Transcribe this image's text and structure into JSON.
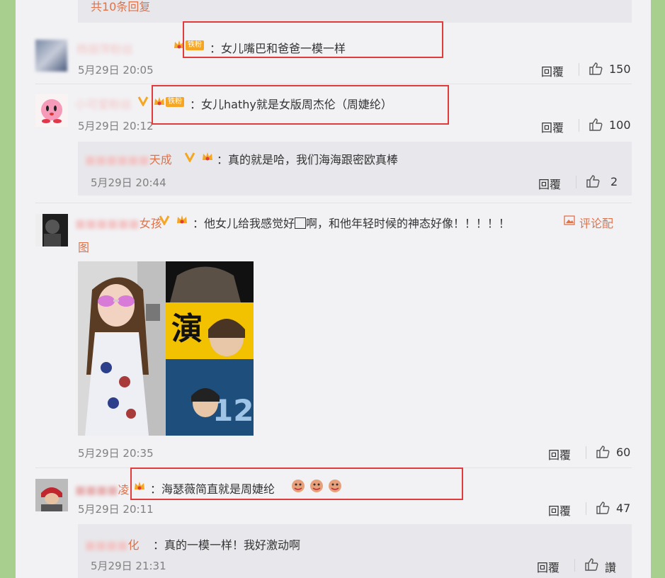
{
  "top_reply_count": "共10条回复",
  "action_reply": "回覆",
  "comments": [
    {
      "username": "杨丽萍粉丝",
      "badge": "铁粉",
      "text": "：女儿嘴巴和爸爸一模一样",
      "time": "5月29日 20:05",
      "likes": "150"
    },
    {
      "username": "小可爱粉丝",
      "badge": "铁粉",
      "text": "：女儿hathy就是女版周杰伦（周婕纶）",
      "time": "5月29日 20:12",
      "likes": "100",
      "reply": {
        "username": "天成",
        "text": "：真的就是哈，我们海海跟密欧真棒",
        "time": "5月29日 20:44",
        "likes": "2"
      }
    },
    {
      "username": "女孩",
      "text_part1": "：他女儿给我感觉好",
      "text_part2": "啊，和他年轻时候的神态好像！！！！！",
      "pic_link_a": "评论配",
      "pic_link_b": "图",
      "poster_char": "演",
      "poster_num": "12",
      "time": "5月29日 20:35",
      "likes": "60"
    },
    {
      "username": "凌",
      "text": "：海瑟薇简直就是周婕纶",
      "time": "5月29日 20:11",
      "likes": "47",
      "reply": {
        "username": "化",
        "text": "：真的一模一样！我好激动啊",
        "time": "5月29日 21:31",
        "likes_label": "讚"
      }
    }
  ]
}
